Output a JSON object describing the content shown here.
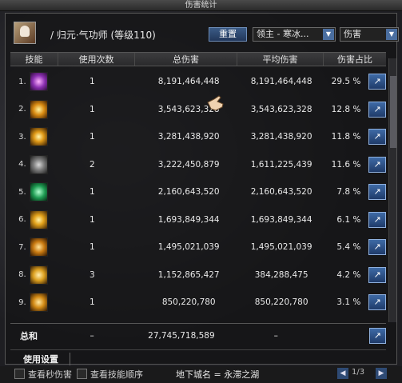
{
  "window": {
    "title": "伤害统计"
  },
  "character": {
    "name": "/ 归元·气功师 (等级110)"
  },
  "toolbar": {
    "reset_label": "重置",
    "target_select": "领主 - 寒冰...",
    "type_select": "伤害"
  },
  "columns": [
    "技能",
    "使用次数",
    "总伤害",
    "平均伤害",
    "伤害占比"
  ],
  "rows": [
    {
      "idx": "1.",
      "icon": "purple-burst-icon",
      "count": "1",
      "total": "8,191,464,448",
      "avg": "8,191,464,448",
      "pct": "29.5 %"
    },
    {
      "idx": "2.",
      "icon": "golden-lion-icon",
      "count": "1",
      "total": "3,543,623,328",
      "avg": "3,543,623,328",
      "pct": "12.8 %"
    },
    {
      "idx": "3.",
      "icon": "golden-figure-icon",
      "count": "1",
      "total": "3,281,438,920",
      "avg": "3,281,438,920",
      "pct": "11.8 %"
    },
    {
      "idx": "4.",
      "icon": "grey-vortex-icon",
      "count": "2",
      "total": "3,222,450,879",
      "avg": "1,611,225,439",
      "pct": "11.6 %"
    },
    {
      "idx": "5.",
      "icon": "green-pillar-icon",
      "count": "1",
      "total": "2,160,643,520",
      "avg": "2,160,643,520",
      "pct": "7.8 %"
    },
    {
      "idx": "6.",
      "icon": "golden-ring-icon",
      "count": "1",
      "total": "1,693,849,344",
      "avg": "1,693,849,344",
      "pct": "6.1 %"
    },
    {
      "idx": "7.",
      "icon": "golden-strike-icon",
      "count": "1",
      "total": "1,495,021,039",
      "avg": "1,495,021,039",
      "pct": "5.4 %"
    },
    {
      "idx": "8.",
      "icon": "golden-wing-icon",
      "count": "3",
      "total": "1,152,865,427",
      "avg": "384,288,475",
      "pct": "4.2 %"
    },
    {
      "idx": "9.",
      "icon": "golden-slash-icon",
      "count": "1",
      "total": "850,220,780",
      "avg": "850,220,780",
      "pct": "3.1 %"
    }
  ],
  "totals": {
    "label": "总和",
    "count": "–",
    "total": "27,745,718,589",
    "avg": "–"
  },
  "settings": {
    "label": "使用设置"
  },
  "bottom": {
    "check_dps_label": "查看秒伤害",
    "check_order_label": "查看技能顺序",
    "dungeon_label": "地下城名 = 永滞之湖",
    "pager": "1/3"
  },
  "colors": {
    "accent": "#3e6aa6",
    "panel": "#141416"
  }
}
